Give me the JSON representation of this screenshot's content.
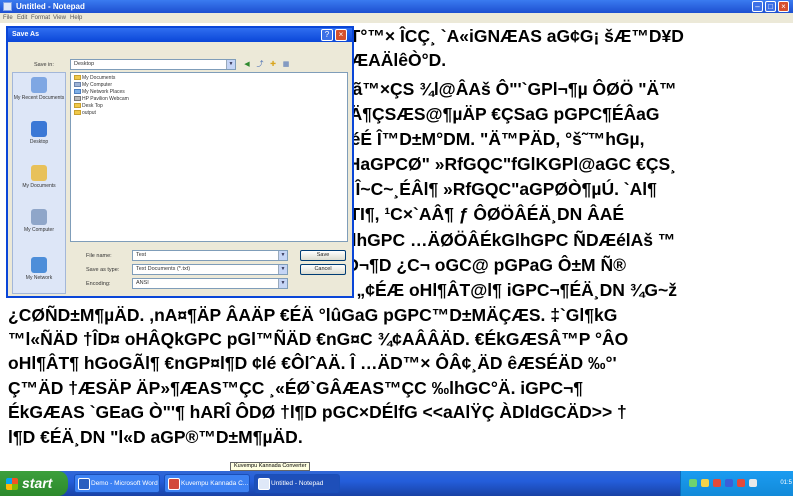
{
  "window": {
    "title": "Untitled - Notepad",
    "menu": [
      "File",
      "Edit",
      "Format",
      "View",
      "Help"
    ]
  },
  "editor": {
    "lines": [
      "ET°™× ÎCÇ¸ `A«iGNÆAS aG¢G¡ šÆ™D¥D",
      "ÑÆAÄlêÒ°D.",
      "Jlã™×ÇS ¾l@ÂAš Ô\"'`GPl¬¶µ ÔØÖ \"Ä™",
      "PÄ¶ÇSÆS@¶µÄP €ÇSaG pGPC¶ÉÂaG",
      "DéÉ Î™D±M°DM. \"Ä™PÄD, °š˜™hGµ,",
      "vHaGPCØ\" »RfGQC\"fGlKGPl@aGC €ÇS¸",
      "N Î~C~¸ÉÂl¶ »RfGQC\"aGPØÒ¶µÚ. `Al¶",
      "ATI¶, ¹C×`AÂ¶ ƒ ÔØÖÂÉÄ¸DN ÂAÉ",
      "GlhGPC …ÄØÖÂÉkGlhGPC ÑDÆélAš ™",
      "\"D¬¶D ¿C¬ oGC@ pGPaG Ô±M Ñ®",
      "O „¢ÉÆ oHl¶ÂT@l¶ iGPC¬¶ÉÄ¸DN ¾G~ž",
      "¿CØÑD±M¶µÄD. ,nA¤¶ÄP ÂAÄP €ÉÄ °lûGaG pGPC™D±MÄÇÆS. ‡`Gl¶kG",
      "™l«ÑÄD †ÎD¤ oHÂQkGPC pGl™ÑÄD €nG¤C ¾¢AÂÂÄD. €ÉkGÆSÂ™P °ÂO",
      "oHl¶ÂT¶ hGoGÃl¶ €nGP¤l¶D ¢lé €ÔlˆAÄ. Î …ÄD™× ÔÂ¢¸ÄD êÆSÉÄD ‰°'",
      "Ç™ÄD †ÆSÄP ÄP»¶ÆAS™ÇC ¸«ÉØ`GÂÆAS™ÇC ‰lhGC°Ä. iGPC¬¶",
      "ÉkGÆAS `GEaG Ò\"'¶ hARÎ ÔDØ †l¶D pGC×DÉlfG <<aAlŸÇ ÀDldGCÄD>> †",
      "l¶D €ÉÄ¸DN \"l«D aGP®™D±M¶µÄD."
    ]
  },
  "dialog": {
    "title": "Save As",
    "save_in_label": "Save in:",
    "save_in_value": "Desktop",
    "places": [
      "My Recent Documents",
      "Desktop",
      "My Documents",
      "My Computer",
      "My Network"
    ],
    "files": [
      "My Documents",
      "My Computer",
      "My Network Places",
      "HP Pavilion Webcam",
      "Desk Top",
      "output"
    ],
    "file_name_label": "File name:",
    "file_name_value": "Test",
    "save_as_type_label": "Save as type:",
    "save_as_type_value": "Text Documents (*.txt)",
    "encoding_label": "Encoding:",
    "encoding_value": "ANSI",
    "save_button": "Save",
    "cancel_button": "Cancel"
  },
  "taskbar": {
    "start_label": "start",
    "tasks": [
      "Demo - Microsoft Word",
      "Kuvempu Kannada C...",
      "Untitled - Notepad"
    ],
    "tooltip": "Kuvempu Kannada Converter",
    "clock": "01:5"
  },
  "colors": {
    "titlebar": "#245edb",
    "dialog_border": "#0a46d8",
    "dialog_face": "#ece9d8",
    "start_button": "#3c9f3c",
    "close_button": "#d5502e"
  }
}
